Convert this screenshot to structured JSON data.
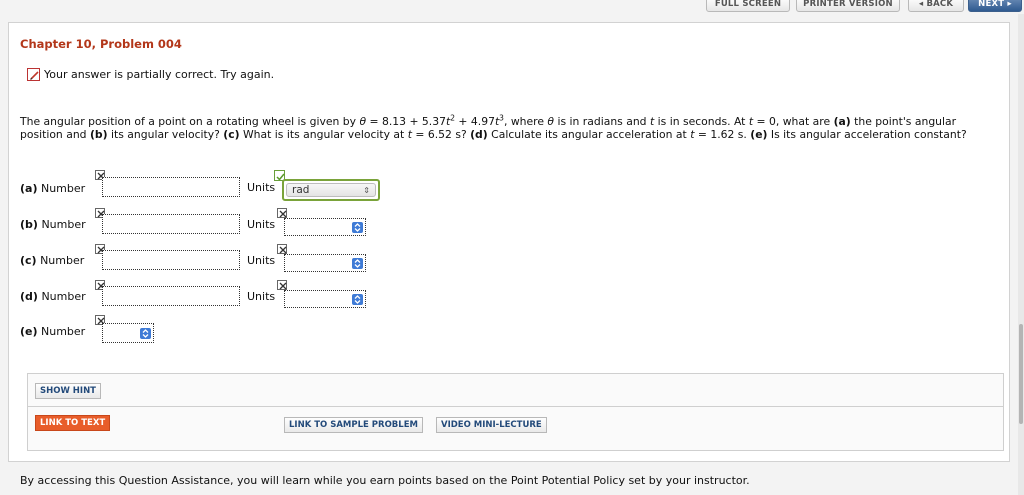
{
  "nav": {
    "full_screen": "FULL SCREEN",
    "printer_version": "PRINTER VERSION",
    "back": "◂ BACK",
    "next": "NEXT ▸"
  },
  "title": "Chapter 10, Problem 004",
  "feedback": "Your answer is partially correct.  Try again.",
  "question": {
    "p1": "The angular position of a point on a rotating wheel is given by ",
    "theta": "θ",
    "p2": " = 8.13 + 5.37",
    "t1": "t",
    "sq": "2",
    "p3": " + 4.97",
    "t2": "t",
    "cube": "3",
    "p4": ", where ",
    "theta2": "θ",
    "p5": " is in radians and ",
    "t3": "t",
    "p6": " is in seconds. At ",
    "t4": "t",
    "p7": " = 0, what are ",
    "a": "(a)",
    "p8": " the point's angular position and ",
    "b": "(b)",
    "p9": " its angular velocity? ",
    "c": "(c)",
    "p10": " What is its angular velocity at ",
    "t5": "t",
    "p11": " = 6.52 s? ",
    "d": "(d)",
    "p12": " Calculate its angular acceleration at ",
    "t6": "t",
    "p13": " = 1.62 s. ",
    "e": "(e)",
    "p14": " Is its angular acceleration constant?"
  },
  "answers": {
    "a": {
      "part": "(a)",
      "label": "Number",
      "units_label": "Units",
      "units_value": "rad",
      "units_arrow": "⇕"
    },
    "b": {
      "part": "(b)",
      "label": "Number",
      "units_label": "Units"
    },
    "c": {
      "part": "(c)",
      "label": "Number",
      "units_label": "Units"
    },
    "d": {
      "part": "(d)",
      "label": "Number",
      "units_label": "Units"
    },
    "e": {
      "part": "(e)",
      "label": "Number"
    }
  },
  "hints": {
    "show_hint": "SHOW HINT",
    "link_to_text": "LINK TO TEXT",
    "link_to_sample": "LINK TO SAMPLE PROBLEM",
    "video": "VIDEO MINI-LECTURE"
  },
  "footer": "By accessing this Question Assistance, you will learn while you earn points based on the Point Potential Policy set by your instructor.",
  "colors": {
    "title": "#b3371a",
    "correct_border": "#7aa33a",
    "spinner": "#3f7bd6",
    "link_to_text_bg": "#e85d2a"
  }
}
